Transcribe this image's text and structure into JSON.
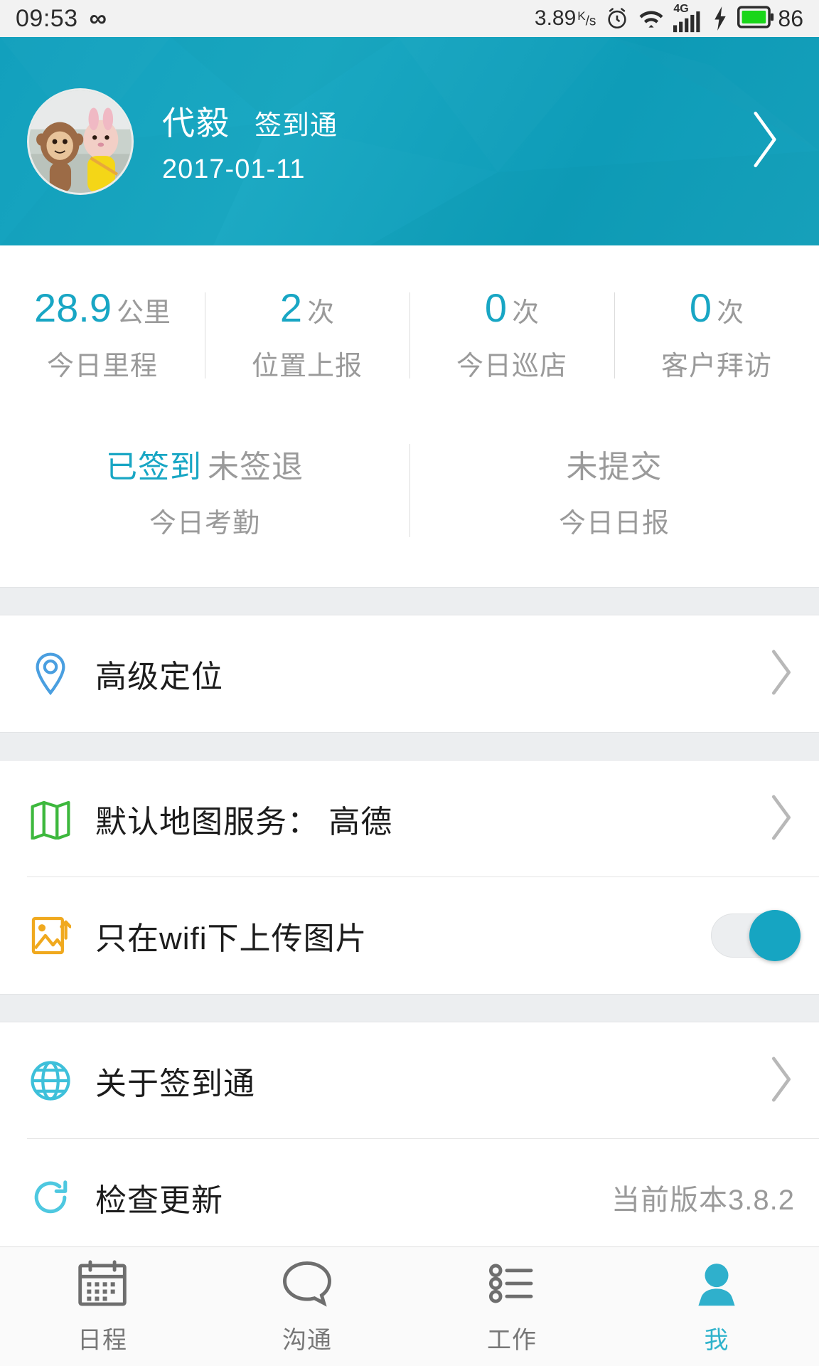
{
  "status_bar": {
    "time": "09:53",
    "infinity_icon": "infinity-icon",
    "net_speed": "3.89",
    "net_speed_unit_top": "K",
    "net_speed_unit_bottom": "s",
    "alarm_icon": "alarm-clock-icon",
    "wifi_icon": "wifi-icon",
    "network_type": "4G",
    "signal_icon": "signal-bars-icon",
    "charging_icon": "charging-bolt-icon",
    "battery_icon": "battery-icon",
    "battery_level": "86"
  },
  "header": {
    "avatar": "user-avatar-photo",
    "name": "代毅",
    "app_name": "签到通",
    "date": "2017-01-11",
    "chevron": "chevron-right-icon",
    "accent_color": "#12a0bd"
  },
  "stats": [
    {
      "value": "28.9",
      "unit": "公里",
      "label": "今日里程"
    },
    {
      "value": "2",
      "unit": "次",
      "label": "位置上报"
    },
    {
      "value": "0",
      "unit": "次",
      "label": "今日巡店"
    },
    {
      "value": "0",
      "unit": "次",
      "label": "客户拜访"
    }
  ],
  "attendance": [
    {
      "status_on": "已签到",
      "status_off": "未签退",
      "label": "今日考勤"
    },
    {
      "status_on": "",
      "status_off": "未提交",
      "label": "今日日报"
    }
  ],
  "settings": {
    "group1": [
      {
        "icon": "location-pin-icon",
        "icon_color": "#4a9fe0",
        "label": "高级定位",
        "value": "",
        "chevron": "chevron-right-icon"
      }
    ],
    "group2": [
      {
        "icon": "map-icon",
        "icon_color": "#3db83d",
        "label": "默认地图服务： 高德",
        "value": "",
        "chevron": "chevron-right-icon"
      },
      {
        "icon": "image-upload-icon",
        "icon_color": "#f0a91e",
        "label": "只在wifi下上传图片",
        "toggle": "on",
        "toggle_color": "#16a5c2"
      }
    ],
    "group3": [
      {
        "icon": "globe-icon",
        "icon_color": "#3ec0da",
        "label": "关于签到通",
        "value": "",
        "chevron": "chevron-right-icon"
      },
      {
        "icon": "refresh-icon",
        "icon_color": "#4ec8e0",
        "label": "检查更新",
        "value": "当前版本3.8.2",
        "chevron": ""
      }
    ]
  },
  "tabbar": [
    {
      "icon": "calendar-icon",
      "label": "日程",
      "active": false
    },
    {
      "icon": "chat-bubble-icon",
      "label": "沟通",
      "active": false
    },
    {
      "icon": "task-list-icon",
      "label": "工作",
      "active": false
    },
    {
      "icon": "person-icon",
      "label": "我",
      "active": true
    }
  ],
  "colors": {
    "accent": "#18a6c4",
    "tab_active": "#2fb3cc",
    "muted": "#9a9a9a"
  }
}
